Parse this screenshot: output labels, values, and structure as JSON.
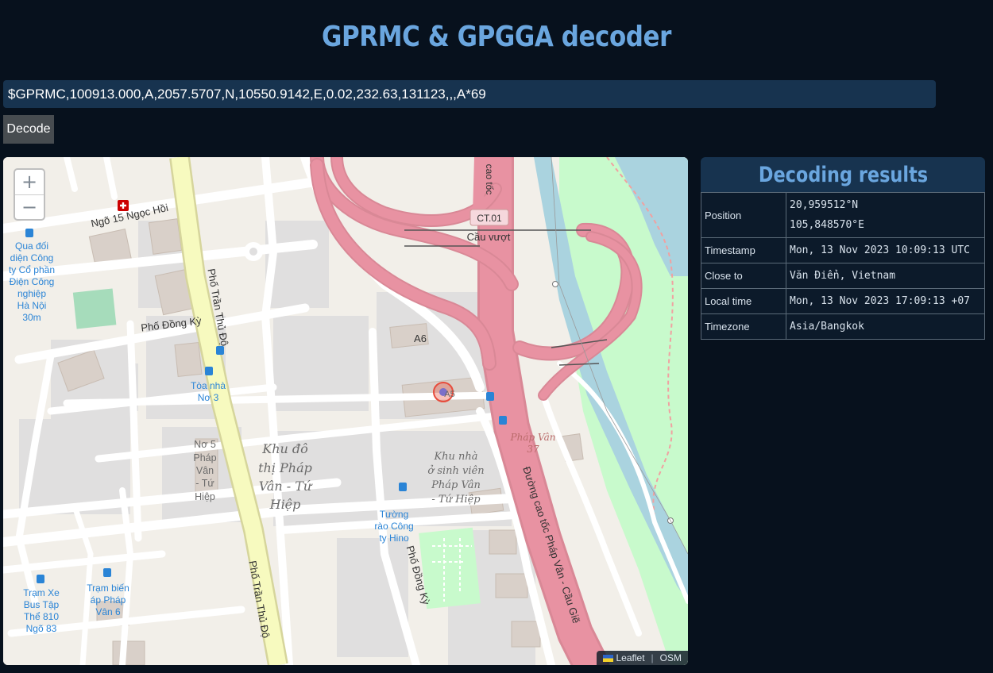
{
  "page": {
    "title": "GPRMC & GPGGA decoder"
  },
  "input": {
    "value": "$GPRMC,100913.000,A,2057.5707,N,10550.9142,E,0.02,232.63,131123,,,A*69"
  },
  "decode_button": {
    "label": "Decode"
  },
  "map": {
    "zoom_in": "+",
    "zoom_out": "−",
    "attribution": {
      "leaflet": "Leaflet",
      "osm": "OSM"
    },
    "labels": {
      "ngo15": "Ngõ 15 Ngọc Hồi",
      "ct01": "CT.01",
      "cauvuot": "Cầu vượt",
      "phodongky": "Phố Đồng Kỳ",
      "a6": "A6",
      "a5": "A5",
      "phapvan37a": "Pháp Vân",
      "phapvan37b": "37",
      "khudothi1": "Khu đô",
      "khudothi2": "thị Pháp",
      "khudothi3": "Vân - Tứ",
      "khudothi4": "Hiệp",
      "khunha1": "Khu nhà",
      "khunha2": "ở sinh viên",
      "khunha3": "Pháp Vân",
      "khunha4": "- Tứ Hiệp",
      "nov5_1": "Nơ 5",
      "nov5_2": "Pháp",
      "nov5_3": "Vân",
      "nov5_4": "- Tứ",
      "nov5_5": "Hiệp",
      "photranthudo": "Phố Trần Thủ Độ",
      "phodongky2": "Phố Đồng Kỳ",
      "duongcaotoc": "Đường cao tốc Pháp Vân - Cầu Giẽ",
      "caotoc_top": "cao tốc",
      "bus1_1": "Qua đối",
      "bus1_2": "diện Công",
      "bus1_3": "ty Cổ phần",
      "bus1_4": "Điện Công",
      "bus1_5": "nghiệp",
      "bus1_6": "Hà Nội",
      "bus1_7": "30m",
      "bus2_1": "Tòa nhà",
      "bus2_2": "Nơ 3",
      "bus3_1": "Tường",
      "bus3_2": "rào Công",
      "bus3_3": "ty Hino",
      "bus4_1": "Trạm Xe",
      "bus4_2": "Bus Tập",
      "bus4_3": "Thể 810",
      "bus4_4": "Ngõ 83",
      "bus5_1": "Trạm biến",
      "bus5_2": "áp Pháp",
      "bus5_3": "Vân 6"
    }
  },
  "results": {
    "title": "Decoding results",
    "position_label": "Position",
    "position_lat": "20,959512°N",
    "position_lon": "105,848570°E",
    "rows": [
      {
        "label": "Timestamp",
        "value": "Mon, 13 Nov 2023 10:09:13 UTC"
      },
      {
        "label": "Close to",
        "value": "Văn Điển, Vietnam"
      },
      {
        "label": "Local time",
        "value": "Mon, 13 Nov 2023 17:09:13 +07"
      },
      {
        "label": "Timezone",
        "value": "Asia/Bangkok"
      }
    ]
  },
  "colors": {
    "background": "#07111d",
    "accent": "#6aa6df",
    "input_bg": "#17334f",
    "motorway": "#e892a2",
    "primary_road": "#f7fabf",
    "park": "#c8facc",
    "water": "#aad3df",
    "marker": "#e74c3c"
  }
}
